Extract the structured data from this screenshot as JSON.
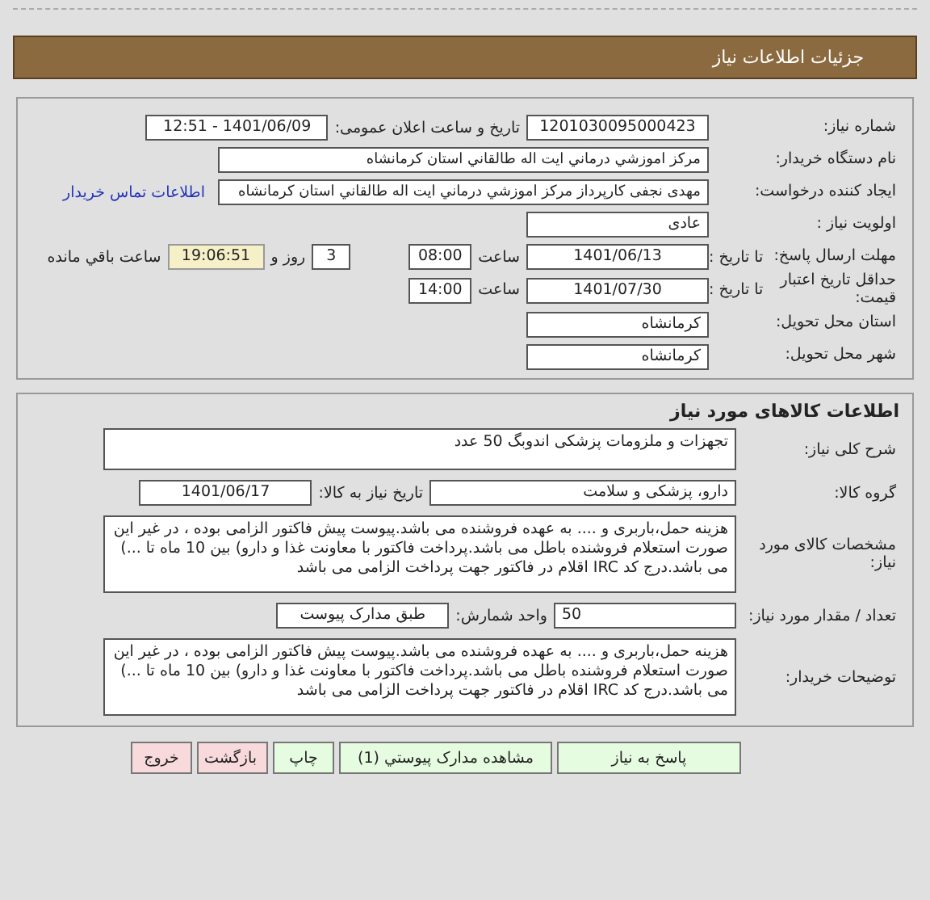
{
  "header": {
    "title": "جزئیات اطلاعات نیاز"
  },
  "general": {
    "rows": [
      {
        "label": "شماره نیاز:",
        "items": [
          {
            "kind": "field",
            "value": "1201030095000423"
          },
          {
            "kind": "label",
            "text": "تاریخ و ساعت اعلان عمومی:"
          },
          {
            "kind": "field",
            "value": "1401/06/09 - 12:51"
          }
        ]
      },
      {
        "label": "نام دستگاه خریدار:",
        "items": [
          {
            "kind": "wide",
            "value": "مرکز اموزشي درماني ايت اله طالقاني استان کرمانشاه"
          }
        ]
      },
      {
        "label": "ایجاد کننده درخواست:",
        "items": [
          {
            "kind": "wide",
            "value": "مهدی نجفی کارپرداز مرکز اموزشي درماني ايت اله طالقاني استان کرمانشاه"
          },
          {
            "kind": "link",
            "text": "اطلاعات تماس خریدار"
          }
        ]
      },
      {
        "label": "اولویت نیاز :",
        "items": [
          {
            "kind": "field",
            "value": "عادی"
          }
        ]
      },
      {
        "label": "مهلت ارسال پاسخ:",
        "sublabel": "تا تاریخ :",
        "items": [
          {
            "kind": "field",
            "value": "1401/06/13"
          },
          {
            "kind": "label",
            "text": "ساعت"
          },
          {
            "kind": "short",
            "value": "08:00"
          },
          {
            "kind": "tiny",
            "value": "3"
          },
          {
            "kind": "label",
            "text": "روز و"
          },
          {
            "kind": "timer",
            "value": "19:06:51"
          },
          {
            "kind": "label",
            "text": "ساعت باقي مانده"
          }
        ]
      },
      {
        "label": "حداقل تاریخ اعتبار قیمت:",
        "sublabel": "تا تاریخ :",
        "items": [
          {
            "kind": "field",
            "value": "1401/07/30"
          },
          {
            "kind": "label",
            "text": "ساعت"
          },
          {
            "kind": "short",
            "value": "14:00"
          }
        ]
      },
      {
        "label": "استان محل تحویل:",
        "items": [
          {
            "kind": "field",
            "value": "کرمانشاه"
          }
        ]
      },
      {
        "label": "شهر محل تحویل:",
        "items": [
          {
            "kind": "field",
            "value": "کرمانشاه"
          }
        ]
      }
    ]
  },
  "goods": {
    "title": "اطلاعات کالاهای مورد نیاز",
    "rows": [
      {
        "label": "شرح کلی نیاز:",
        "items": [
          {
            "kind": "box",
            "value": "تجهزات و ملزومات پزشکی اندوبگ  50 عدد"
          }
        ]
      },
      {
        "label": "گروه کالا:",
        "items": [
          {
            "kind": "long",
            "value": "دارو، پزشکی و سلامت"
          },
          {
            "kind": "label",
            "text": "تاریخ نیاز به کالا:"
          },
          {
            "kind": "date",
            "value": "1401/06/17"
          }
        ]
      },
      {
        "label": "مشخصات کالای مورد نیاز:",
        "items": [
          {
            "kind": "area",
            "value": "هزینه حمل،باربری و .... به عهده فروشنده می باشد.پیوست پیش فاکتور الزامی بوده ، در غیر این صورت استعلام فروشنده باطل می باشد.پرداخت فاکتور با معاونت غذا و دارو) بین 10 ماه تا ...) می باشد.درج کد IRC اقلام در فاکتور جهت پرداخت الزامی می باشد"
          }
        ]
      },
      {
        "label": "تعداد / مقدار مورد نیاز:",
        "items": [
          {
            "kind": "field",
            "value": "50"
          },
          {
            "kind": "label",
            "text": "واحد شمارش:"
          },
          {
            "kind": "date",
            "value": "طبق مدارک پیوست"
          }
        ]
      },
      {
        "label": "توضیحات خریدار:",
        "items": [
          {
            "kind": "area",
            "value": "هزینه حمل،باربری و .... به عهده فروشنده می باشد.پیوست پیش فاکتور الزامی بوده ، در غیر این صورت استعلام فروشنده باطل می باشد.پرداخت فاکتور با معاونت غذا و دارو) بین 10 ماه تا ...) می باشد.درج کد IRC اقلام در فاکتور جهت پرداخت الزامی می باشد"
          }
        ]
      }
    ]
  },
  "buttons": [
    {
      "label": "پاسخ به نیاز",
      "color": "#e6fce0"
    },
    {
      "label": "مشاهده مدارک پیوستي (1)",
      "color": "#e6fce0"
    },
    {
      "label": "چاپ",
      "color": "#e6fce0"
    },
    {
      "label": "بازگشت",
      "color": "#f8dadc"
    },
    {
      "label": "خروج",
      "color": "#f8dadc"
    }
  ]
}
